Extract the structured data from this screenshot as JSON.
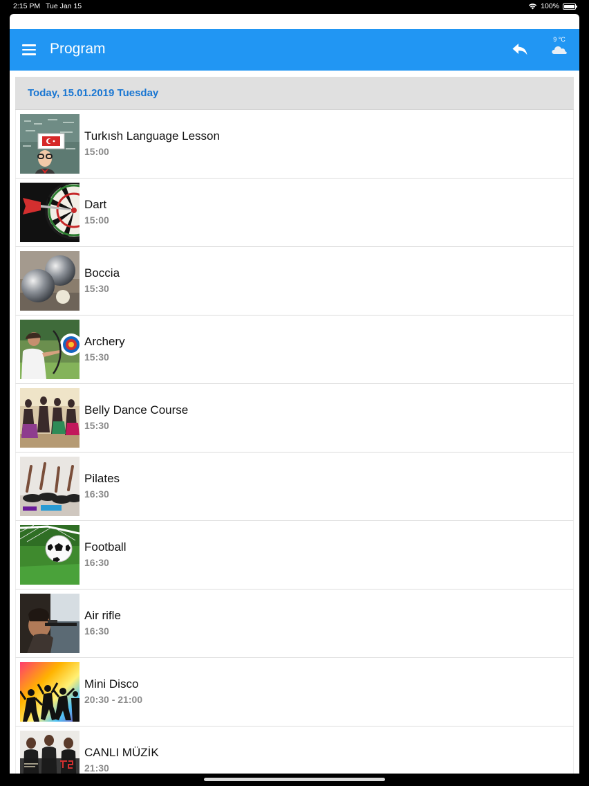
{
  "status_bar": {
    "time": "2:15 PM",
    "date": "Tue Jan 15",
    "battery": "100%",
    "battery_level": 1.0
  },
  "app_bar": {
    "title": "Program",
    "color": "#2196f3",
    "weather": {
      "temperature": "9 °C",
      "icon": "cloud-icon"
    }
  },
  "program": {
    "date_header": "Today, 15.01.2019 Tuesday",
    "items": [
      {
        "title": "Turkısh Language Lesson",
        "time": "15:00",
        "image": "turkish-lesson-photo"
      },
      {
        "title": "Dart",
        "time": "15:00",
        "image": "dart-photo"
      },
      {
        "title": "Boccia",
        "time": "15:30",
        "image": "boccia-photo"
      },
      {
        "title": "Archery",
        "time": "15:30",
        "image": "archery-photo"
      },
      {
        "title": "Belly Dance Course",
        "time": "15:30",
        "image": "belly-dance-photo"
      },
      {
        "title": "Pilates",
        "time": "16:30",
        "image": "pilates-photo"
      },
      {
        "title": "Football",
        "time": "16:30",
        "image": "football-photo"
      },
      {
        "title": "Air rifle",
        "time": "16:30",
        "image": "air-rifle-photo"
      },
      {
        "title": "Mini Disco",
        "time": "20:30 - 21:00",
        "image": "mini-disco-photo"
      },
      {
        "title": "CANLI MÜZİK",
        "time": "21:30",
        "image": "live-music-photo"
      }
    ]
  }
}
